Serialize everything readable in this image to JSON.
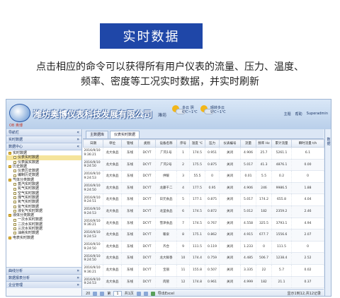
{
  "banner": "实时数据",
  "description": [
    "点击相应的命令可以获得所有用户仪表的流量、压力、温度、",
    "频率、密度等工况实时数据，并实时刷新"
  ],
  "app": {
    "logo_text": "OB 奥博",
    "company": "潍坊奥博仪表科技发展有限公司",
    "city": "潍坊",
    "weather": [
      {
        "line1": "多云 阴",
        "line2": "6℃~1℃"
      },
      {
        "line1": "晴转多云",
        "line2": "9℃~1℃"
      }
    ],
    "user": [
      "主题",
      "帮助",
      "Superadmin"
    ]
  },
  "sidebar": {
    "header": "导航栏",
    "sections_top": [
      "实时数据",
      "数据中心"
    ],
    "tree": [
      {
        "label": "实时数据",
        "level": 0,
        "type": "folder"
      },
      {
        "label": "仪表实时数据",
        "level": 1,
        "type": "file",
        "selected": true
      },
      {
        "label": "仪表属实数据",
        "level": 1,
        "type": "file"
      },
      {
        "label": "历史数据",
        "level": 0,
        "type": "folder"
      },
      {
        "label": "仪表历史数据",
        "level": 1,
        "type": "file"
      },
      {
        "label": "编制历史数据",
        "level": 1,
        "type": "file"
      },
      {
        "label": "气体分类数据",
        "level": 0,
        "type": "folder"
      },
      {
        "label": "蒸汽实时数据",
        "level": 1,
        "type": "file"
      },
      {
        "label": "氮气实时数据",
        "level": 1,
        "type": "file"
      },
      {
        "label": "空气实时数据",
        "level": 1,
        "type": "file"
      },
      {
        "label": "煤气实时数据",
        "level": 1,
        "type": "file"
      },
      {
        "label": "氧气实时数据",
        "level": 1,
        "type": "file"
      },
      {
        "label": "氩气实时数据",
        "level": 1,
        "type": "file"
      },
      {
        "label": "液化气实时数据",
        "level": 1,
        "type": "file"
      },
      {
        "label": "液体分类数据",
        "level": 0,
        "type": "folder"
      },
      {
        "label": "一次水实时数据",
        "level": 1,
        "type": "file"
      },
      {
        "label": "二次水实时数据",
        "level": 1,
        "type": "file"
      },
      {
        "label": "三次水实时数据",
        "level": 1,
        "type": "file"
      },
      {
        "label": "油耗实时数据",
        "level": 1,
        "type": "file"
      },
      {
        "label": "电表实时数据",
        "level": 0,
        "type": "folder"
      }
    ],
    "sections_bottom": [
      "曲线分析",
      "数据报表分析",
      "企业管理"
    ]
  },
  "tabs": [
    "主数据库",
    "仪表实时数据"
  ],
  "table": {
    "columns": [
      "日期",
      "单位",
      "管线",
      "类别",
      "设备名称",
      "序号",
      "温度 ℃",
      "压力",
      "仪表编号",
      "流量",
      "频率 Hz",
      "累计流量",
      "瞬时流量 t/h"
    ],
    "rows": [
      [
        "2016/9/10 9:36:21",
        "龙大食品",
        "东线",
        "DCYT",
        "厂内1号",
        "1",
        "174.5",
        "0.951",
        "关闭",
        "4.906",
        "25.7",
        "5261.1",
        "6.1"
      ],
      [
        "2016/9/10 9:24:50",
        "龙大食品",
        "东线",
        "DCYT",
        "厂内2号",
        "2",
        "175.5",
        "0.875",
        "关闭",
        "5.017",
        "41.3",
        "4876.1",
        "0.00"
      ],
      [
        "2016/9/10 9:24:53",
        "龙大食品",
        "东线",
        "DCYT",
        "供暖",
        "3",
        "55.5",
        "0",
        "关闭",
        "0.01",
        "5.5",
        "0.2",
        "0"
      ],
      [
        "2016/9/10 9:24:50",
        "龙大食品",
        "东线",
        "DCYT",
        "龙藤千二",
        "4",
        "177.5",
        "0.95",
        "关闭",
        "4.906",
        "246",
        "9986.5",
        "1.88"
      ],
      [
        "2016/9/10 9:24:51",
        "龙大食品",
        "东线",
        "DCYT",
        "日元食品",
        "5",
        "177.1",
        "0.875",
        "关闭",
        "5.017",
        "174.2",
        "655.8",
        "4.04"
      ],
      [
        "2016/9/10 9:24:53",
        "龙大食品",
        "东线",
        "DCYT",
        "龙里食品",
        "6",
        "174.5",
        "0.872",
        "关闭",
        "5.012",
        "182",
        "2359.2",
        "2.46"
      ],
      [
        "2016/9/10 9:36:21",
        "龙大食品",
        "东线",
        "DCYT",
        "雪津食品",
        "7",
        "174.5",
        "0.767",
        "关闭",
        "4.558",
        "325.5",
        "3793.1",
        "4.94"
      ],
      [
        "2016/9/10 9:24:53",
        "龙大食品",
        "东线",
        "DCYT",
        "暖泉",
        "8",
        "175.1",
        "0.862",
        "关闭",
        "4.915",
        "677.7",
        "1556.6",
        "2.07"
      ],
      [
        "2016/9/10 9:24:50",
        "龙大食品",
        "东线",
        "DCYT",
        "齐合",
        "9",
        "111.5",
        "0.119",
        "关闭",
        "1.233",
        "0",
        "111.5",
        "0"
      ],
      [
        "2016/9/10 9:24:50",
        "龙大食品",
        "东线",
        "DCYT",
        "龙大鲜香",
        "10",
        "174.4",
        "0.759",
        "关闭",
        "4.485",
        "506.7",
        "1238.4",
        "2.52"
      ],
      [
        "2016/9/10 9:36:21",
        "龙大食品",
        "东线",
        "DCYT",
        "宝丽",
        "11",
        "155.8",
        "0.507",
        "关闭",
        "3.335",
        "22",
        "5.7",
        "0.02"
      ],
      [
        "2016/9/10 9:24:53",
        "龙大食品",
        "东线",
        "DCYT",
        "肉管",
        "12",
        "174.8",
        "0.961",
        "关闭",
        "4.999",
        "182",
        "21.1",
        "0.37"
      ]
    ]
  },
  "pager": {
    "page_size": "20",
    "page_label": "第",
    "page_value": "1",
    "page_total": "共1页",
    "export": "导出Excel",
    "summary": "显示1到12,共12记录"
  },
  "right_panel": "数据"
}
